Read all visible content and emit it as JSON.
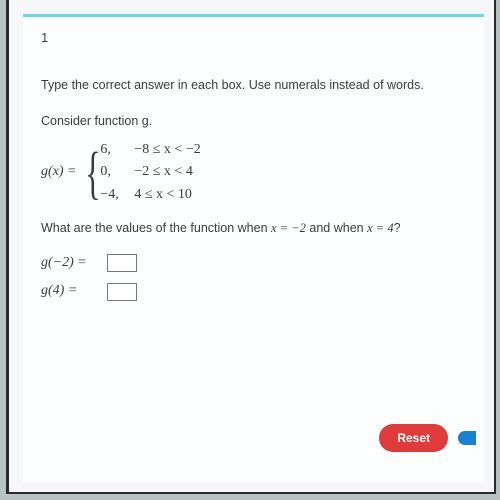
{
  "question_number": "1",
  "instruction": "Type the correct answer in each box. Use numerals instead of words.",
  "consider": "Consider function g.",
  "piecewise": {
    "lhs": "g(x)  =",
    "rows": [
      {
        "value": "6,",
        "condition": "−8 ≤ x < −2"
      },
      {
        "value": "0,",
        "condition": "−2 ≤ x < 4"
      },
      {
        "value": "−4,",
        "condition": "4 ≤ x < 10"
      }
    ]
  },
  "prompt": {
    "pre": "What are the values of the function when ",
    "x1": "x = −2",
    "mid": " and when ",
    "x2": "x = 4",
    "post": "?"
  },
  "inputs": [
    {
      "label": "g(−2)  =",
      "value": ""
    },
    {
      "label": "g(4)  =",
      "value": ""
    }
  ],
  "buttons": {
    "reset": "Reset"
  }
}
